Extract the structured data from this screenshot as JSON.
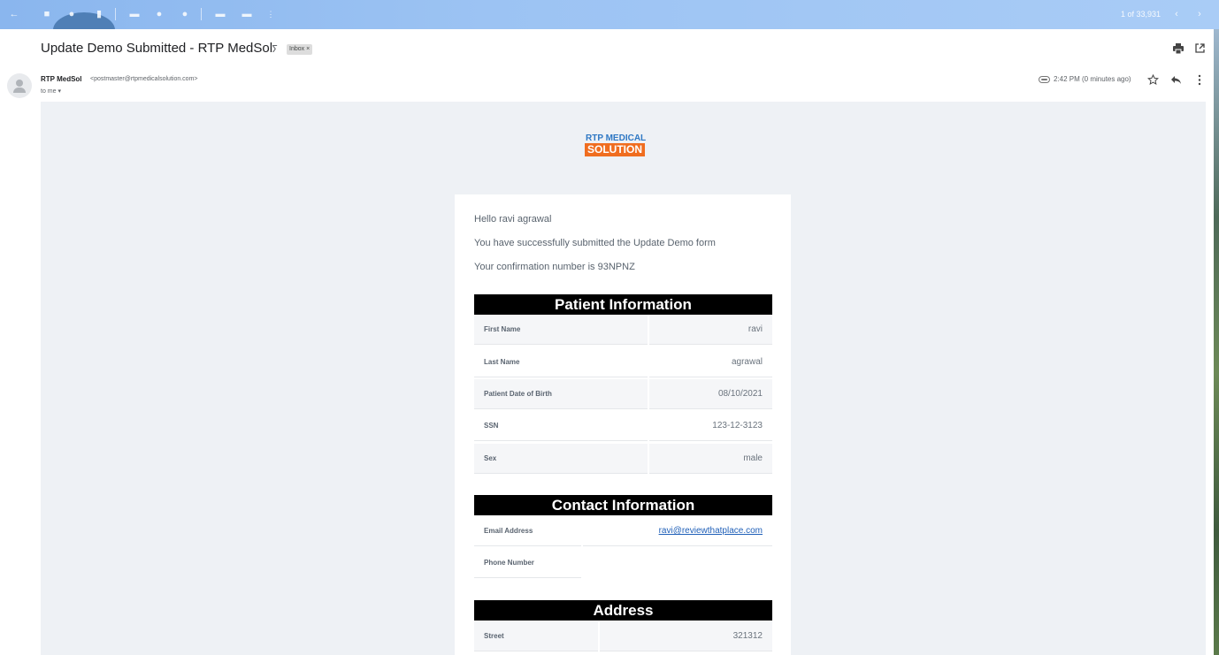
{
  "toolbar": {
    "message_count": "1 of 33,931"
  },
  "email": {
    "subject": "Update Demo Submitted - RTP MedSol",
    "label": "Inbox ×",
    "sender_name": "RTP MedSol",
    "sender_email": "<postmaster@rtpmedicalsolution.com>",
    "recipient": "to me ▾",
    "time": "2:42 PM (0 minutes ago)"
  },
  "body": {
    "logo_top": "RTP MEDICAL",
    "logo_bottom": "SOLUTION",
    "greeting": "Hello ravi agrawal",
    "message": "You have successfully submitted the Update Demo form",
    "confirmation": "Your confirmation number is 93NPNZ",
    "patient": {
      "heading": "Patient Information",
      "rows": [
        {
          "label": "First Name",
          "value": "ravi"
        },
        {
          "label": "Last Name",
          "value": "agrawal"
        },
        {
          "label": "Patient Date of Birth",
          "value": "08/10/2021"
        },
        {
          "label": "SSN",
          "value": "123-12-3123"
        },
        {
          "label": "Sex",
          "value": "male"
        }
      ]
    },
    "contact": {
      "heading": "Contact Information",
      "rows": [
        {
          "label": "Email Address",
          "value": "ravi@reviewthatplace.com"
        },
        {
          "label": "Phone Number",
          "value": ""
        }
      ]
    },
    "address": {
      "heading": "Address",
      "rows": [
        {
          "label": "Street",
          "value": "321312"
        }
      ]
    }
  }
}
